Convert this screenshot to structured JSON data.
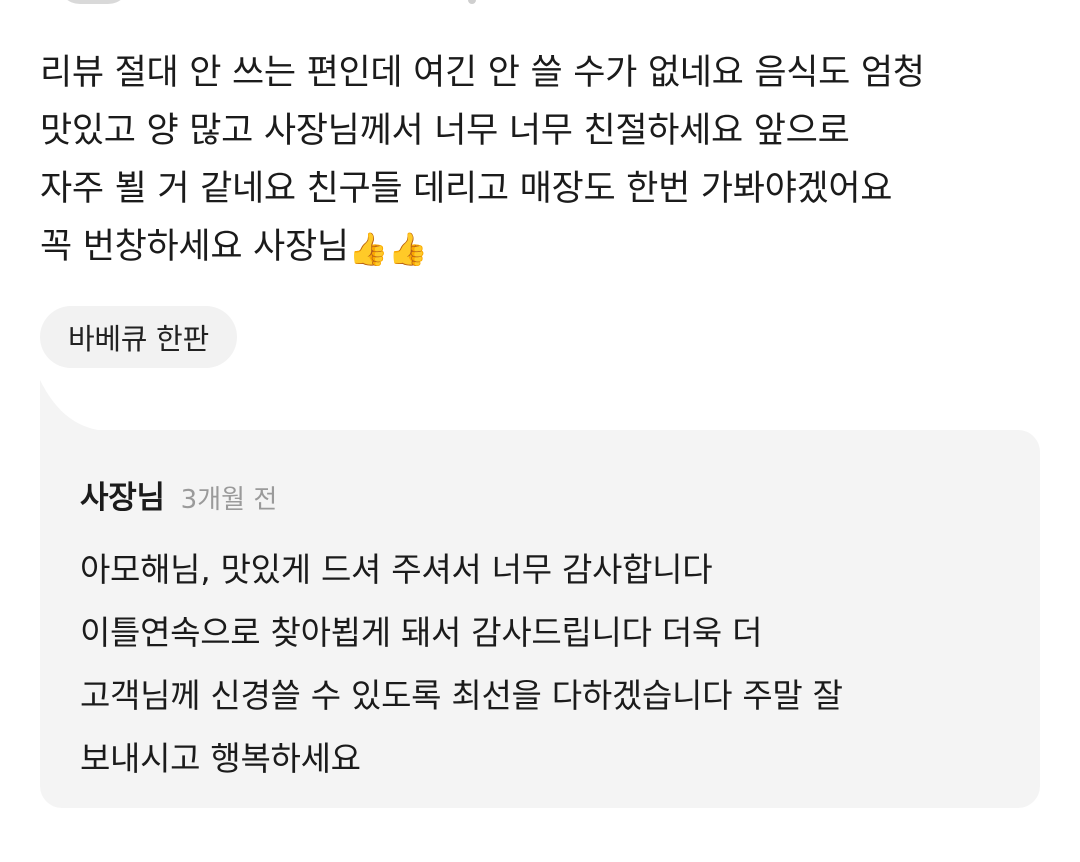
{
  "review": {
    "lines": [
      "리뷰 절대 안 쓰는 편인데 여긴 안 쓸 수가 없네요 음식도 엄청",
      "맛있고 양 많고 사장님께서 너무 너무 친절하세요 앞으로",
      "자주 뵐 거 같네요 친구들 데리고 매장도 한번 가봐야겠어요",
      "꼭 번창하세요 사장님"
    ],
    "emoji": "👍👍"
  },
  "menu_chip": {
    "label": "바베큐 한판"
  },
  "reply": {
    "author": "사장님",
    "time": "3개월 전",
    "lines": [
      "아모해님, 맛있게 드셔 주셔서 너무 감사합니다",
      "이틀연속으로 찾아뵙게 돼서 감사드립니다 더욱 더",
      "고객님께 신경쓸 수 있도록 최선을 다하겠습니다 주말 잘",
      "보내시고 행복하세요"
    ]
  },
  "colors": {
    "reply_background": "#f4f4f4",
    "chip_background": "#f2f2f2",
    "meta_text": "#9a9a9a"
  }
}
